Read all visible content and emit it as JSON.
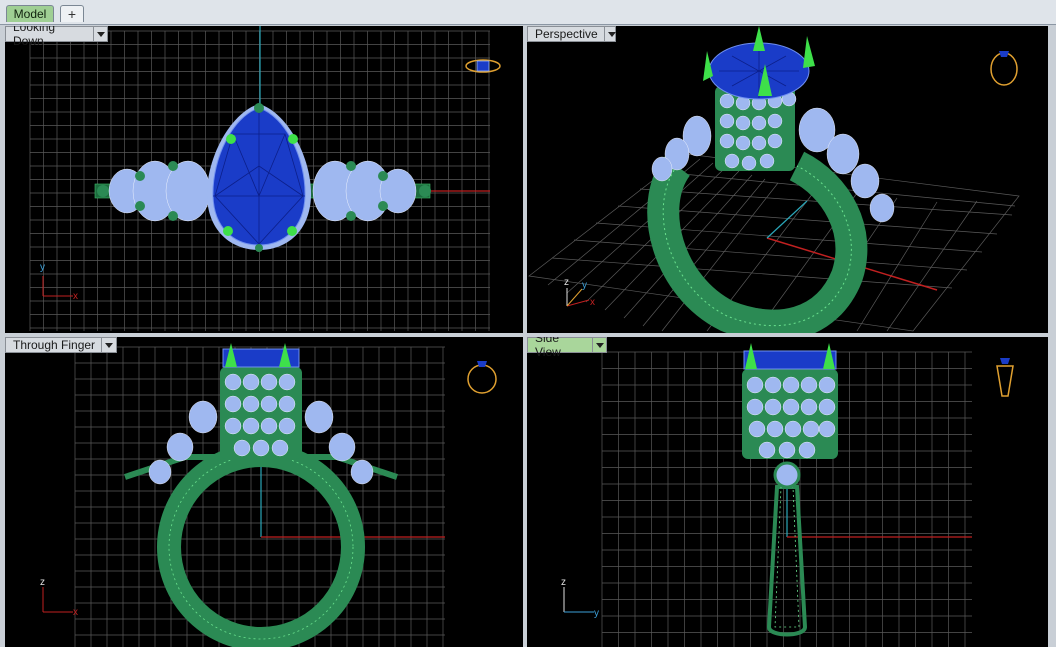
{
  "tabs": {
    "model_label": "Model",
    "add_label": "+"
  },
  "viewports": [
    {
      "title": "Looking Down",
      "axes": [
        "y",
        "x"
      ]
    },
    {
      "title": "Perspective",
      "axes": [
        "z",
        "y",
        "x"
      ]
    },
    {
      "title": "Through Finger",
      "axes": [
        "z",
        "x"
      ]
    },
    {
      "title": "Side View",
      "axes": [
        "z",
        "y"
      ]
    }
  ],
  "colors": {
    "grid": "#5a5a5a",
    "background": "#000000",
    "band": "#2b8a54",
    "gem_blue": "#1a3cc8",
    "stone": "#9fb8f0",
    "prong": "#3ee04a",
    "x_axis": "#c02020",
    "y_axis": "#2aa6b8",
    "widget": "#e0a030",
    "active_tab": "#a9d69b"
  },
  "icons": [
    "ring-widget-icon",
    "dropdown-arrow-icon"
  ]
}
